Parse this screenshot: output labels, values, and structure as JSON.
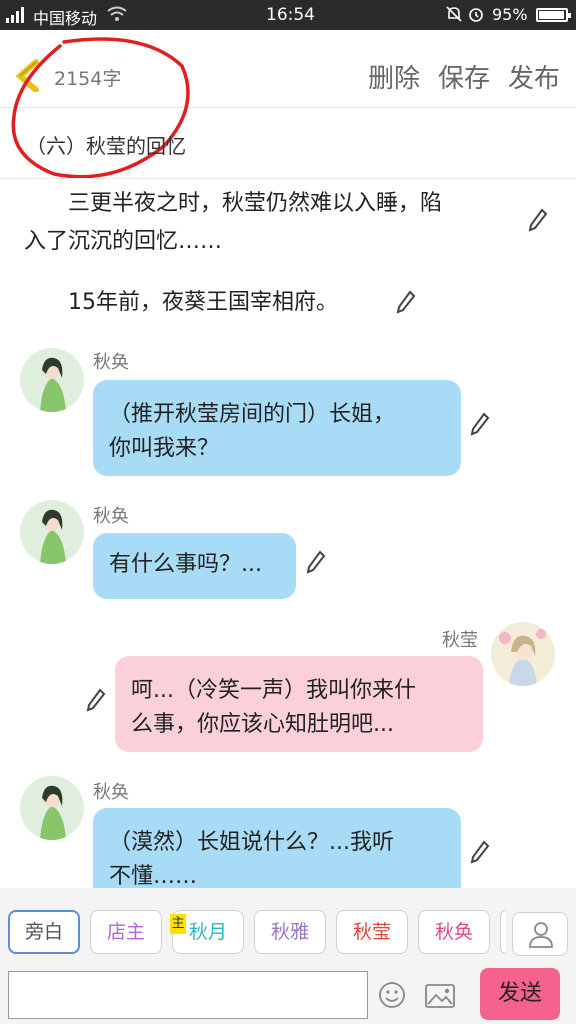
{
  "status_bar": {
    "carrier": "中国移动",
    "time": "16:54",
    "battery": "95%",
    "battery_level": 0.95
  },
  "header": {
    "word_count": "2154字",
    "delete_label": "删除",
    "save_label": "保存",
    "publish_label": "发布"
  },
  "chapter_title": "（六）秋莹的回忆",
  "narration": [
    {
      "line1": "　　三更半夜之时，秋莹仍然难以入睡，陷",
      "line2": "入了沉沉的回忆……"
    },
    {
      "line1": "　　15年前，夜葵王国宰相府。"
    }
  ],
  "messages": [
    {
      "speaker": "秋奂",
      "line1": "（推开秋莹房间的门）长姐，",
      "line2": "你叫我来？"
    },
    {
      "speaker": "秋奂",
      "line1": "有什么事吗？..."
    },
    {
      "speaker": "秋莹",
      "line1": "呵...（冷笑一声）我叫你来什",
      "line2": "么事，你应该心知肚明吧..."
    },
    {
      "speaker": "秋奂",
      "line1": "（漠然）长姐说什么？...我听",
      "line2": "不懂……"
    }
  ],
  "roles": [
    {
      "label": "旁白",
      "color": "#555555"
    },
    {
      "label": "店主",
      "color": "#b069d8"
    },
    {
      "label": "秋月",
      "color": "#2fb6c4"
    },
    {
      "label": "秋雅",
      "color": "#9a74c8"
    },
    {
      "label": "秋莹",
      "color": "#e0463a"
    },
    {
      "label": "秋奂",
      "color": "#e04a8a"
    }
  ],
  "host_badge": "主",
  "input": {
    "value": "",
    "placeholder": ""
  },
  "send_label": "发送",
  "colors": {
    "accent": "#f6628e",
    "bubble_blue": "#a8dcf6",
    "bubble_pink": "#fbd0da",
    "back_arrow": "#e8c21a",
    "annotation": "#e02020"
  }
}
